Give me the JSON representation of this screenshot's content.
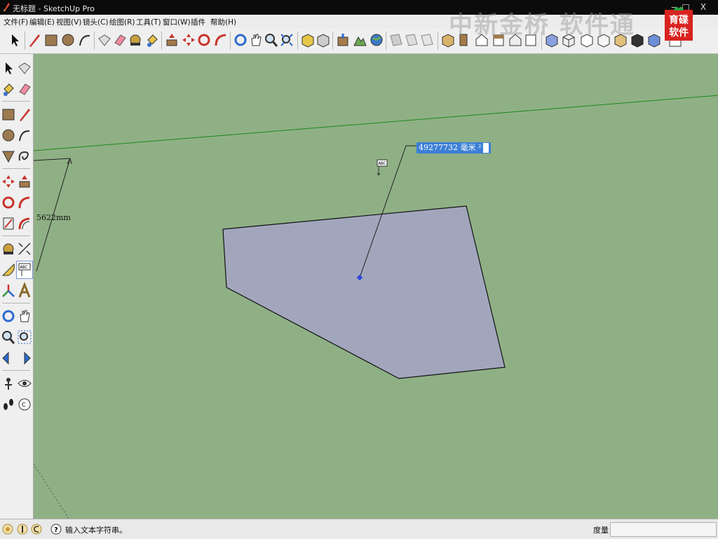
{
  "window": {
    "title": "无标题 - SketchUp Pro",
    "minimize": "‒",
    "restore": "□",
    "close": "X"
  },
  "menu": [
    {
      "label": "文件(F)"
    },
    {
      "label": "编辑(E)"
    },
    {
      "label": "视图(V)"
    },
    {
      "label": "镜头(C)"
    },
    {
      "label": "绘图(R)"
    },
    {
      "label": "工具(T)"
    },
    {
      "label": "窗口(W)"
    },
    {
      "label": "插件"
    },
    {
      "label": "帮助(H)"
    }
  ],
  "watermark": "中新金桥 软件通",
  "logo_text": [
    "育碟",
    "软件"
  ],
  "viewport": {
    "dimension_label": "5622mm",
    "area_label": "49277732 毫米 ²",
    "background": "#8fb085",
    "face_color": "#a2a6bd",
    "axis_color": "#1a8a1a"
  },
  "status": {
    "message": "输入文本字符串。",
    "measure_label": "度量",
    "measure_value": ""
  }
}
